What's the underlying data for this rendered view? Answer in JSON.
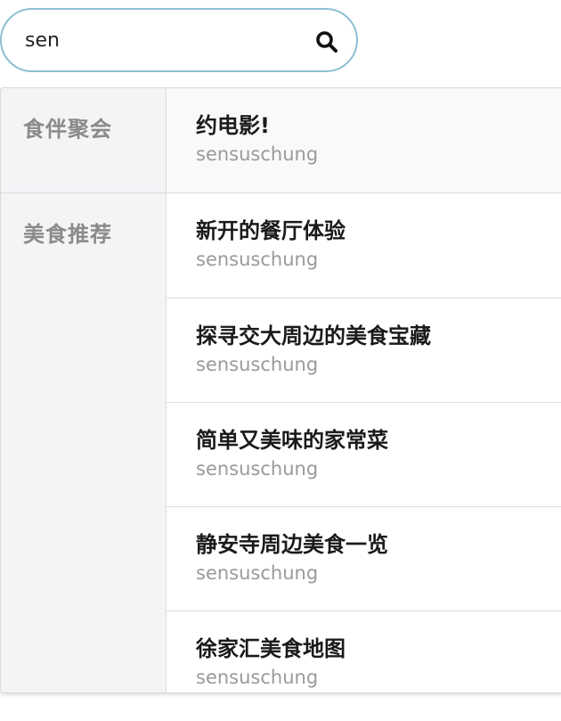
{
  "search": {
    "value": "sen",
    "icon": "search-icon"
  },
  "categories": [
    {
      "label": "食伴聚会",
      "items": [
        {
          "title": "约电影!",
          "author": "sensuschung"
        }
      ]
    },
    {
      "label": "美食推荐",
      "items": [
        {
          "title": "新开的餐厅体验",
          "author": "sensuschung"
        },
        {
          "title": "探寻交大周边的美食宝藏",
          "author": "sensuschung"
        },
        {
          "title": "简单又美味的家常菜",
          "author": "sensuschung"
        },
        {
          "title": "静安寺周边美食一览",
          "author": "sensuschung"
        },
        {
          "title": "徐家汇美食地图",
          "author": "sensuschung"
        }
      ]
    }
  ],
  "colors": {
    "search_border": "#8fbfd6",
    "category_bg": "#f3f4f6",
    "category_text": "#8a8a8a",
    "title_text": "#1a1a1a",
    "author_text": "#9a9a9a"
  }
}
